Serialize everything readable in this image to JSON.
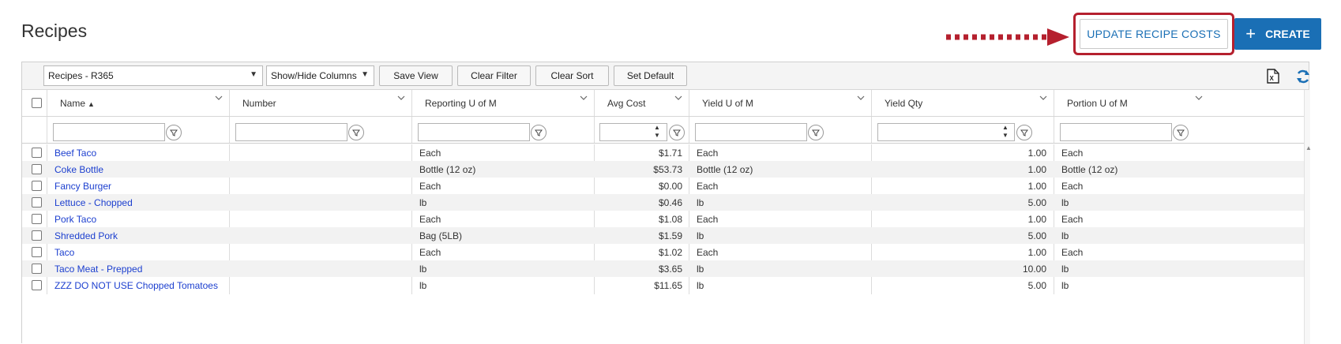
{
  "page": {
    "title": "Recipes"
  },
  "actions": {
    "update_label": "UPDATE RECIPE COSTS",
    "create_label": "CREATE",
    "create_icon": "plus-icon"
  },
  "colors": {
    "accent": "#1a6fb5",
    "highlight": "#b5202e",
    "link": "#1c3fcf"
  },
  "toolbar": {
    "view_select": "Recipes - R365",
    "columns_select": "Show/Hide Columns",
    "save_view": "Save View",
    "clear_filter": "Clear Filter",
    "clear_sort": "Clear Sort",
    "set_default": "Set Default"
  },
  "columns": [
    "Name",
    "Number",
    "Reporting U of M",
    "Avg Cost",
    "Yield U of M",
    "Yield Qty",
    "Portion U of M"
  ],
  "sort": {
    "column": "Name",
    "direction": "ascending"
  },
  "rows": [
    {
      "name": "Beef Taco",
      "number": "",
      "reporting_uom": "Each",
      "avg_cost": "$1.71",
      "yield_uom": "Each",
      "yield_qty": "1.00",
      "portion_uom": "Each"
    },
    {
      "name": "Coke Bottle",
      "number": "",
      "reporting_uom": "Bottle (12 oz)",
      "avg_cost": "$53.73",
      "yield_uom": "Bottle (12 oz)",
      "yield_qty": "1.00",
      "portion_uom": "Bottle (12 oz)"
    },
    {
      "name": "Fancy Burger",
      "number": "",
      "reporting_uom": "Each",
      "avg_cost": "$0.00",
      "yield_uom": "Each",
      "yield_qty": "1.00",
      "portion_uom": "Each"
    },
    {
      "name": "Lettuce - Chopped",
      "number": "",
      "reporting_uom": "lb",
      "avg_cost": "$0.46",
      "yield_uom": "lb",
      "yield_qty": "5.00",
      "portion_uom": "lb"
    },
    {
      "name": "Pork Taco",
      "number": "",
      "reporting_uom": "Each",
      "avg_cost": "$1.08",
      "yield_uom": "Each",
      "yield_qty": "1.00",
      "portion_uom": "Each"
    },
    {
      "name": "Shredded Pork",
      "number": "",
      "reporting_uom": "Bag (5LB)",
      "avg_cost": "$1.59",
      "yield_uom": "lb",
      "yield_qty": "5.00",
      "portion_uom": "lb"
    },
    {
      "name": "Taco",
      "number": "",
      "reporting_uom": "Each",
      "avg_cost": "$1.02",
      "yield_uom": "Each",
      "yield_qty": "1.00",
      "portion_uom": "Each"
    },
    {
      "name": "Taco Meat - Prepped",
      "number": "",
      "reporting_uom": "lb",
      "avg_cost": "$3.65",
      "yield_uom": "lb",
      "yield_qty": "10.00",
      "portion_uom": "lb"
    },
    {
      "name": "ZZZ DO NOT USE Chopped Tomatoes",
      "number": "",
      "reporting_uom": "lb",
      "avg_cost": "$11.65",
      "yield_uom": "lb",
      "yield_qty": "5.00",
      "portion_uom": "lb"
    }
  ]
}
